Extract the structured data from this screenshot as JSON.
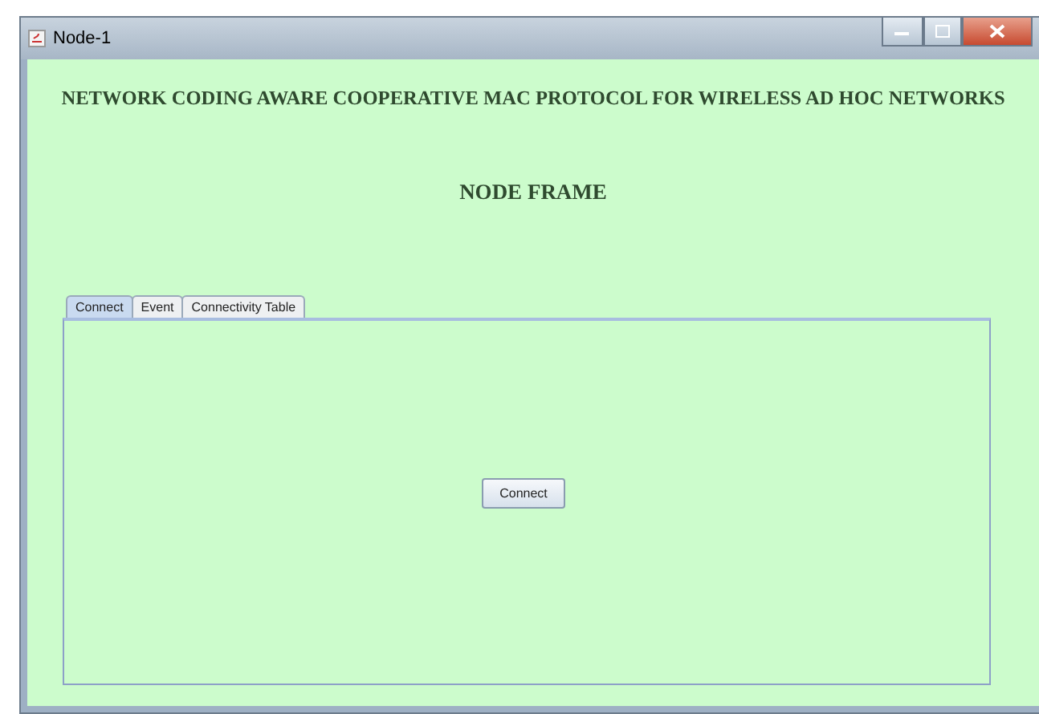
{
  "window": {
    "title": "Node-1"
  },
  "heading": "NETWORK CODING AWARE COOPERATIVE MAC PROTOCOL FOR WIRELESS AD HOC NETWORKS",
  "subheading": "NODE FRAME",
  "tabs": [
    {
      "label": "Connect",
      "selected": true
    },
    {
      "label": "Event",
      "selected": false
    },
    {
      "label": "Connectivity Table",
      "selected": false
    }
  ],
  "panel": {
    "button": "Connect"
  }
}
